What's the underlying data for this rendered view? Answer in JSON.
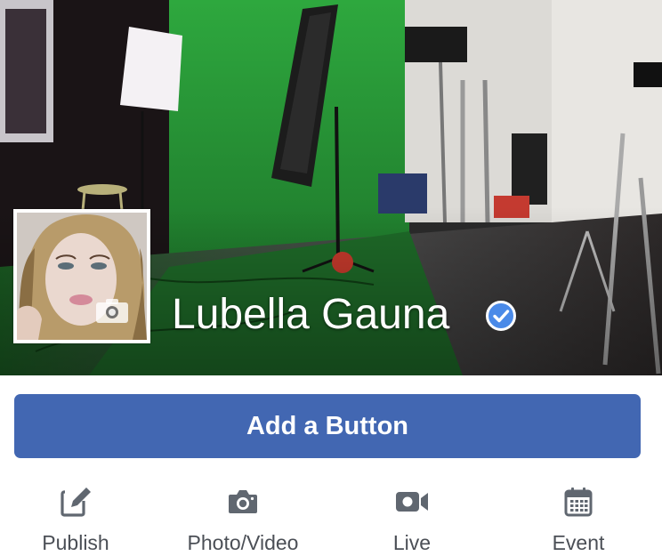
{
  "page": {
    "name": "Lubella Gauna",
    "verified": true
  },
  "cta": {
    "label": "Add a Button"
  },
  "actions": [
    {
      "label": "Publish",
      "icon": "edit-icon"
    },
    {
      "label": "Photo/Video",
      "icon": "camera-icon"
    },
    {
      "label": "Live",
      "icon": "video-camera-icon"
    },
    {
      "label": "Event",
      "icon": "calendar-icon"
    }
  ],
  "colors": {
    "brand": "#4267b2",
    "verified_badge": "#4a8ae8",
    "action_icon": "#606770",
    "action_label": "#4b4f56"
  }
}
